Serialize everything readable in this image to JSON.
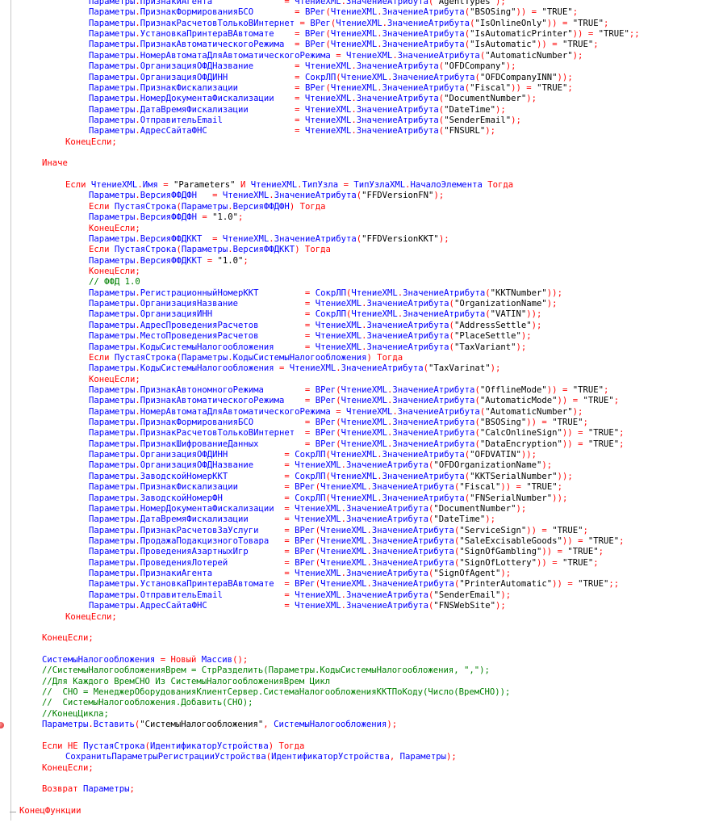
{
  "editor": {
    "colors": {
      "keyword": "#ff0000",
      "identifier": "#0000ff",
      "string": "#000000",
      "comment": "#008000",
      "gutter": "#c8c8c8",
      "background": "#ffffff"
    },
    "lines": [
      "        Параметры.ПризнакиАгента              = ЧтениеXML.ЗначениеАтрибута(\"AgentTypes\");",
      "        Параметры.ПризнакФормированияБСО        = ВРег(ЧтениеXML.ЗначениеАтрибута(\"BSOSing\")) = \"TRUE\";",
      "        Параметры.ПризнакРасчетовТолькоВИнтернет = ВРег(ЧтениеXML.ЗначениеАтрибута(\"IsOnlineOnly\")) = \"TRUE\";",
      "        Параметры.УстановкаПринтераВАвтомате    = ВРег(ЧтениеXML.ЗначениеАтрибута(\"IsAutomaticPrinter\")) = \"TRUE\";;",
      "        Параметры.ПризнакАвтоматическогоРежима  = ВРег(ЧтениеXML.ЗначениеАтрибута(\"IsAutomatic\")) = \"TRUE\";",
      "        Параметры.НомерАвтоматаДляАвтоматическогоРежима = ЧтениеXML.ЗначениеАтрибута(\"AutomaticNumber\");",
      "        Параметры.ОрганизацияОФДНазвание        = ЧтениеXML.ЗначениеАтрибута(\"OFDCompany\");",
      "        Параметры.ОрганизацияОФДИНН             = СокрЛП(ЧтениеXML.ЗначениеАтрибута(\"OFDCompanyINN\"));",
      "        Параметры.ПризнакФискализации           = ВРег(ЧтениеXML.ЗначениеАтрибута(\"Fiscal\")) = \"TRUE\";",
      "        Параметры.НомерДокументаФискализации    = ЧтениеXML.ЗначениеАтрибута(\"DocumentNumber\");",
      "        Параметры.ДатаВремяФискализации         = ЧтениеXML.ЗначениеАтрибута(\"DateTime\");",
      "        Параметры.ОтправительEmail              = ЧтениеXML.ЗначениеАтрибута(\"SenderEmail\");",
      "        Параметры.АдресСайтаФНС                 = ЧтениеXML.ЗначениеАтрибута(\"FNSURL\");",
      "    КонецЕсли;",
      "",
      "Иначе",
      "",
      "    Если ЧтениеXML.Имя = \"Parameters\" И ЧтениеXML.ТипУзла = ТипУзлаXML.НачалоЭлемента Тогда",
      "        Параметры.ВерсияФФДФН   = ЧтениеXML.ЗначениеАтрибута(\"FFDVersionFN\");",
      "        Если ПустаяСтрока(Параметры.ВерсияФФДФН) Тогда",
      "            Параметры.ВерсияФФДФН = \"1.0\";",
      "        КонецЕсли;",
      "        Параметры.ВерсияФФДККТ  = ЧтениеXML.ЗначениеАтрибута(\"FFDVersionKKT\");",
      "        Если ПустаяСтрока(Параметры.ВерсияФФДККТ) Тогда",
      "            Параметры.ВерсияФФДККТ = \"1.0\";",
      "        КонецЕсли;",
      "        // ФФД 1.0",
      "        Параметры.РегистрационныйНомерККТ         = СокрЛП(ЧтениеXML.ЗначениеАтрибута(\"KKTNumber\"));",
      "        Параметры.ОрганизацияНазвание             = ЧтениеXML.ЗначениеАтрибута(\"OrganizationName\");",
      "        Параметры.ОрганизацияИНН                  = СокрЛП(ЧтениеXML.ЗначениеАтрибута(\"VATIN\"));",
      "        Параметры.АдресПроведенияРасчетов         = ЧтениеXML.ЗначениеАтрибута(\"AddressSettle\");",
      "        Параметры.МестоПроведенияРасчетов         = ЧтениеXML.ЗначениеАтрибута(\"PlaceSettle\");",
      "        Параметры.КодыСистемыНалогообложения      = ЧтениеXML.ЗначениеАтрибута(\"TaxVariant\");",
      "        Если ПустаяСтрока(Параметры.КодыСистемыНалогообложения) Тогда",
      "            Параметры.КодыСистемыНалогообложения = ЧтениеXML.ЗначениеАтрибута(\"TaxVarinat\");",
      "        КонецЕсли;",
      "        Параметры.ПризнакАвтономногоРежима        = ВРег(ЧтениеXML.ЗначениеАтрибута(\"OfflineMode\")) = \"TRUE\";",
      "        Параметры.ПризнакАвтоматическогоРежима    = ВРег(ЧтениеXML.ЗначениеАтрибута(\"AutomaticMode\")) = \"TRUE\";",
      "        Параметры.НомерАвтоматаДляАвтоматическогоРежима = ЧтениеXML.ЗначениеАтрибута(\"AutomaticNumber\");",
      "        Параметры.ПризнакФормированияБСО          = ВРег(ЧтениеXML.ЗначениеАтрибута(\"BSOSing\")) = \"TRUE\";",
      "        Параметры.ПризнакРасчетовТолькоВИнтернет  = ВРег(ЧтениеXML.ЗначениеАтрибута(\"CalcOnlineSign\")) = \"TRUE\";",
      "        Параметры.ПризнакШифрованиеДанных         = ВРег(ЧтениеXML.ЗначениеАтрибута(\"DataEncryption\")) = \"TRUE\";",
      "        Параметры.ОрганизацияОФДИНН           = СокрЛП(ЧтениеXML.ЗначениеАтрибута(\"OFDVATIN\"));",
      "        Параметры.ОрганизацияОФДНазвание      = ЧтениеXML.ЗначениеАтрибута(\"OFDOrganizationName\");",
      "        Параметры.ЗаводскойНомерККТ           = СокрЛП(ЧтениеXML.ЗначениеАтрибута(\"KKTSerialNumber\"));",
      "        Параметры.ПризнакФискализации         = ВРег(ЧтениеXML.ЗначениеАтрибута(\"Fiscal\")) = \"TRUE\";",
      "        Параметры.ЗаводскойНомерФН            = СокрЛП(ЧтениеXML.ЗначениеАтрибута(\"FNSerialNumber\"));",
      "        Параметры.НомерДокументаФискализации  = ЧтениеXML.ЗначениеАтрибута(\"DocumentNumber\");",
      "        Параметры.ДатаВремяФискализации       = ЧтениеXML.ЗначениеАтрибута(\"DateTime\");",
      "        Параметры.ПризнакРасчетовЗаУслуги     = ВРег(ЧтениеXML.ЗначениеАтрибута(\"ServiceSign\")) = \"TRUE\";",
      "        Параметры.ПродажаПодакцизногоТовара   = ВРег(ЧтениеXML.ЗначениеАтрибута(\"SaleExcisableGoods\")) = \"TRUE\";",
      "        Параметры.ПроведенияАзартныхИгр       = ВРег(ЧтениеXML.ЗначениеАтрибута(\"SignOfGambling\")) = \"TRUE\";",
      "        Параметры.ПроведенияЛотерей           = ВРег(ЧтениеXML.ЗначениеАтрибута(\"SignOfLottery\")) = \"TRUE\";",
      "        Параметры.ПризнакиАгента              = ЧтениеXML.ЗначениеАтрибута(\"SignOfAgent\");",
      "        Параметры.УстановкаПринтераВАвтомате  = ВРег(ЧтениеXML.ЗначениеАтрибута(\"PrinterAutomatic\")) = \"TRUE\";;",
      "        Параметры.ОтправительEmail            = ЧтениеXML.ЗначениеАтрибута(\"SenderEmail\");",
      "        Параметры.АдресСайтаФНС               = ЧтениеXML.ЗначениеАтрибута(\"FNSWebSite\");",
      "    КонецЕсли;",
      "",
      "КонецЕсли;",
      "",
      "СистемыНалогообложения = Новый Массив();",
      "//СистемыНалогообложенияВрем = СтрРазделить(Параметры.КодыСистемыНалогообложения, \",\");",
      "//Для Каждого ВремСНО Из СистемыНалогообложенияВрем Цикл",
      "//  СНО = МенеджерОборудованияКлиентСервер.СистемаНалогообложенияККТПоКоду(Число(ВремСНО));",
      "//  СистемыНалогообложения.Добавить(СНО);",
      "//КонецЦикла;",
      "Параметры.Вставить(\"СистемыНалогообложения\", СистемыНалогообложения);",
      "",
      "Если НЕ ПустаяСтрока(ИдентификаторУстройства) Тогда",
      "    СохранитьПараметрыРегистрацииУстройства(ИдентификаторУстройства, Параметры);",
      "КонецЕсли;",
      "",
      "Возврат Параметры;",
      "",
      "КонецФункции"
    ]
  }
}
